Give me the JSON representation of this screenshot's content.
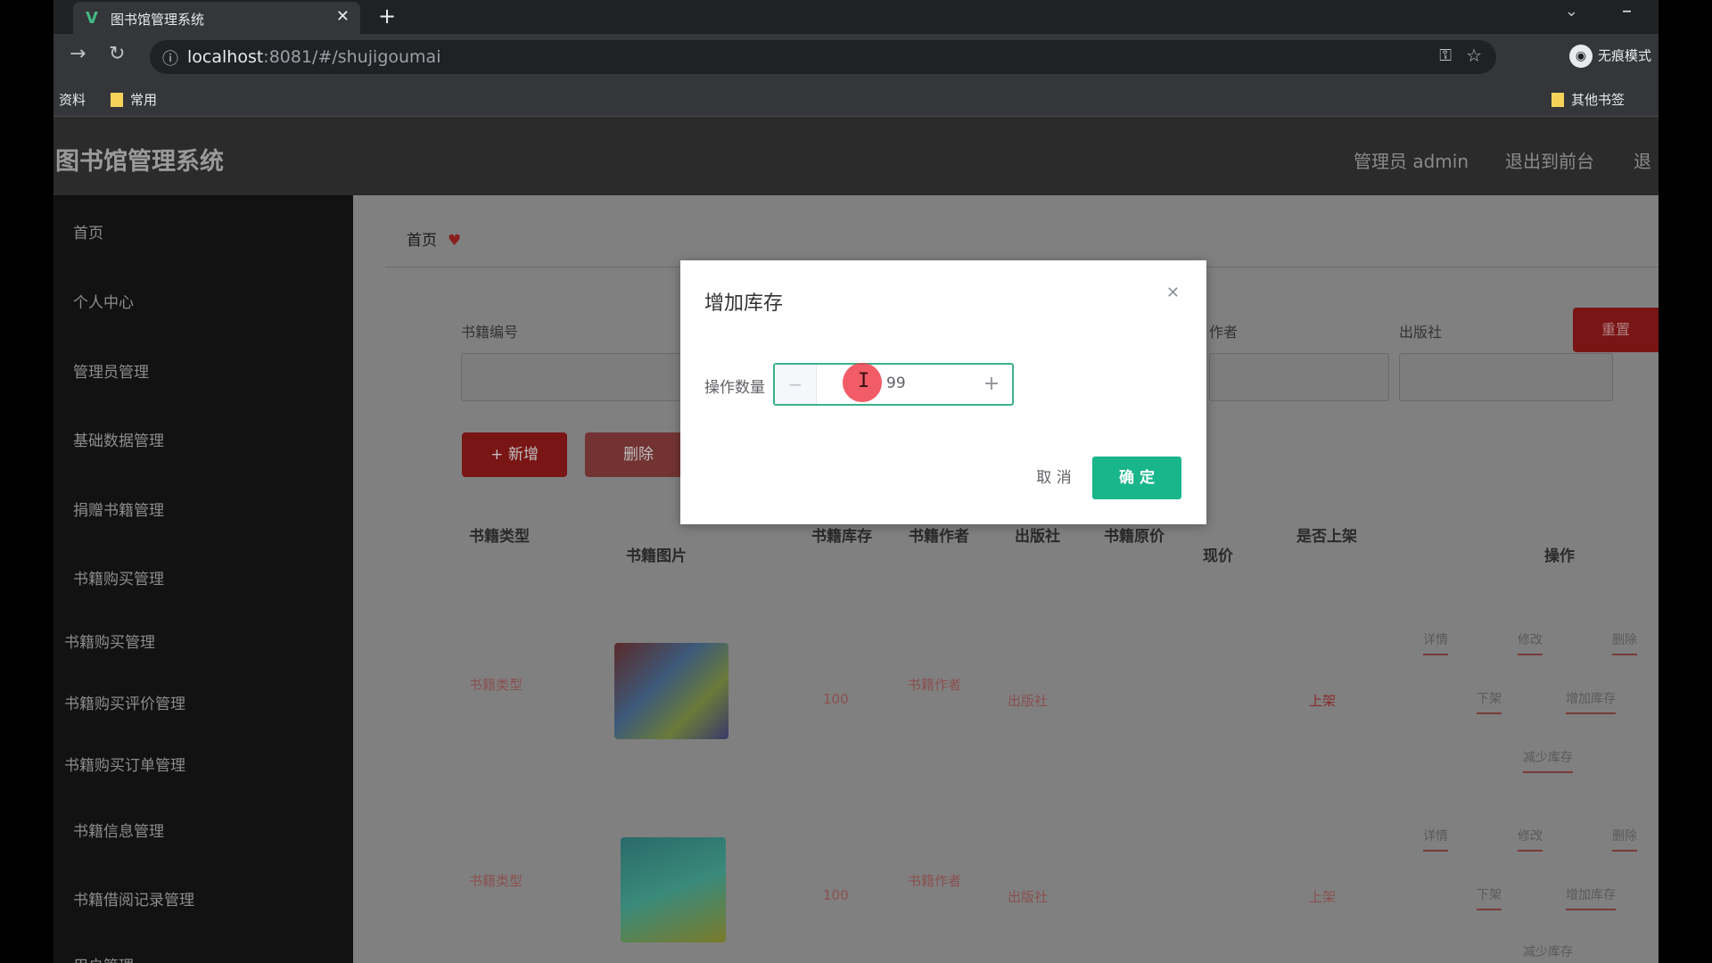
{
  "browser": {
    "tab_title": "图书馆管理系统",
    "url_host": "localhost",
    "url_rest": ":8081/#/shujigoumai",
    "incognito_label": "无痕模式",
    "bookmarks": [
      "资料",
      "常用"
    ],
    "other_bookmarks": "其他书签"
  },
  "app": {
    "title": "图书馆管理系统",
    "admin_label": "管理员 admin",
    "exit_front": "退出到前台",
    "logout_partial": "退"
  },
  "sidebar": {
    "items": [
      "首页",
      "个人中心",
      "管理员管理",
      "基础数据管理",
      "捐赠书籍管理",
      "书籍购买管理",
      "书籍购买管理",
      "书籍购买评价管理",
      "书籍购买订单管理",
      "书籍信息管理",
      "书籍借阅记录管理",
      "用户管理"
    ]
  },
  "breadcrumb": {
    "home": "首页"
  },
  "search": {
    "labels": [
      "书籍编号",
      "作者",
      "出版社"
    ]
  },
  "buttons": {
    "add": "+ 新增",
    "delete": "删除",
    "reset": "重置"
  },
  "table": {
    "headers": [
      "书籍类型",
      "书籍图片",
      "书籍库存",
      "书籍作者",
      "出版社",
      "书籍原价",
      "现价",
      "是否上架",
      "操作"
    ],
    "rows": [
      {
        "type": "书籍类型",
        "stock": "100",
        "author": "书籍作者",
        "publisher": "出版社",
        "status": "上架"
      },
      {
        "type": "书籍类型",
        "stock": "100",
        "author": "书籍作者",
        "publisher": "出版社",
        "status": "上架"
      }
    ],
    "row_actions": [
      "详情",
      "修改",
      "删除",
      "下架",
      "增加库存",
      "减少库存"
    ]
  },
  "modal": {
    "title": "增加库存",
    "label": "操作数量",
    "value": "99",
    "cancel": "取 消",
    "confirm": "确 定"
  },
  "colors": {
    "confirm": "#1ab68b",
    "accent_red": "#7a1515"
  }
}
